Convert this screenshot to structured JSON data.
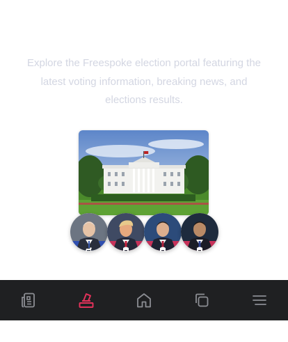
{
  "intro": {
    "text": "Explore the Freespoke election portal featuring the latest voting information, breaking news, and elections results."
  },
  "hero": {
    "image_icon": "white-house-photo"
  },
  "candidates": [
    {
      "party": "democrat",
      "badge_icon": "donkey-icon",
      "badge_color": "#2f4fb0"
    },
    {
      "party": "republican",
      "badge_icon": "elephant-icon",
      "badge_color": "#c8325a"
    },
    {
      "party": "republican",
      "badge_icon": "elephant-icon",
      "badge_color": "#c8325a"
    },
    {
      "party": "republican",
      "badge_icon": "elephant-icon",
      "badge_color": "#c8325a"
    }
  ],
  "tabbar": {
    "background": "#1f2022",
    "active_color": "#e2325a",
    "inactive_color": "#8c8e94",
    "tabs": [
      {
        "icon": "news-icon",
        "active": false
      },
      {
        "icon": "ballot-box-icon",
        "active": true
      },
      {
        "icon": "home-icon",
        "active": false
      },
      {
        "icon": "copy-icon",
        "active": false
      },
      {
        "icon": "menu-icon",
        "active": false
      }
    ]
  }
}
